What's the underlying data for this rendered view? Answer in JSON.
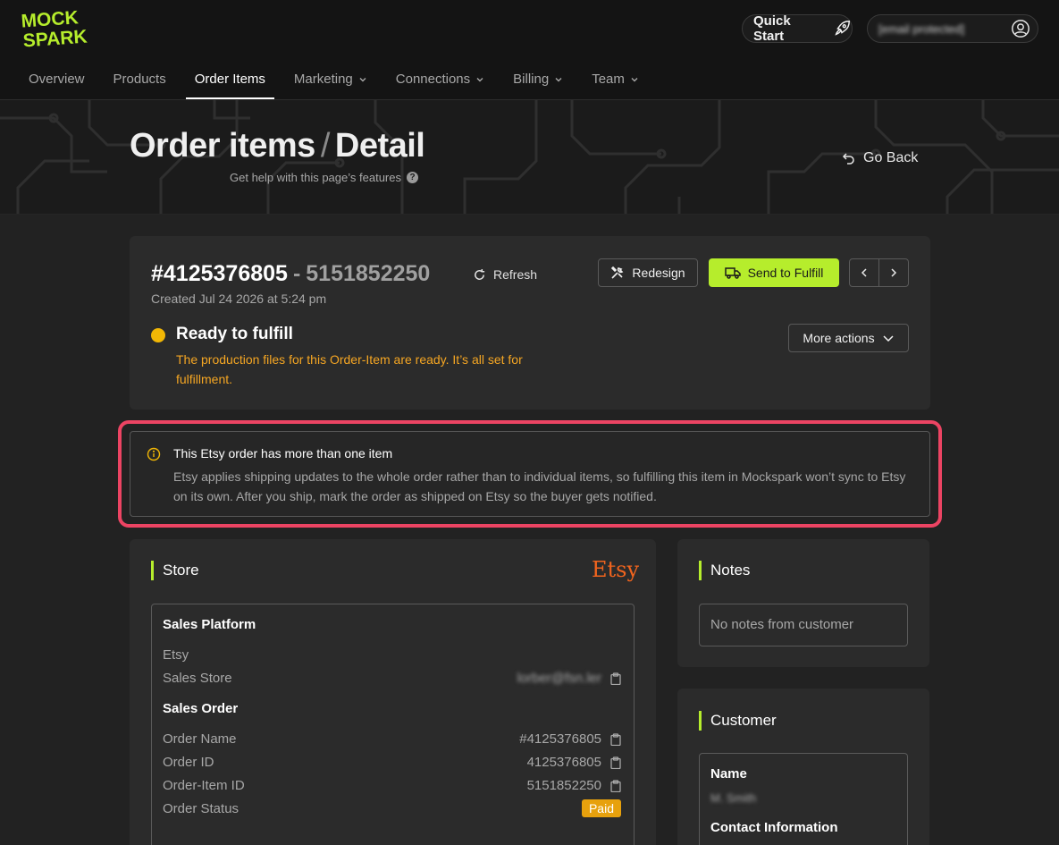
{
  "brand": {
    "logo_line1": "MOCK",
    "logo_line2": "SPARK",
    "accent": "#b6ed2c"
  },
  "header": {
    "quick_start": "Quick Start",
    "account_email": "[email protected]",
    "nav": [
      {
        "label": "Overview",
        "dropdown": false,
        "active": false
      },
      {
        "label": "Products",
        "dropdown": false,
        "active": false
      },
      {
        "label": "Order Items",
        "dropdown": false,
        "active": true
      },
      {
        "label": "Marketing",
        "dropdown": true,
        "active": false
      },
      {
        "label": "Connections",
        "dropdown": true,
        "active": false
      },
      {
        "label": "Billing",
        "dropdown": true,
        "active": false
      },
      {
        "label": "Team",
        "dropdown": true,
        "active": false
      }
    ]
  },
  "hero": {
    "title_part1": "Order items",
    "separator": "/",
    "title_part2": "Detail",
    "help_text": "Get help with this page’s features",
    "go_back": "Go Back"
  },
  "order": {
    "number": "#4125376805",
    "dash": "-",
    "item_id": "5151852250",
    "refresh": "Refresh",
    "created": "Created Jul 24 2026 at 5:24 pm",
    "redesign": "Redesign",
    "send_to_fulfill": "Send to Fulfill",
    "more_actions": "More actions",
    "status_title": "Ready to fulfill",
    "status_desc": "The production files for this Order-Item are ready. It’s all set for fulfillment.",
    "status_color": "#f2b705"
  },
  "alert": {
    "title": "This Etsy order has more than one item",
    "body": "Etsy applies shipping updates to the whole order rather than to individual items, so fulfilling this item in Mockspark won’t sync to Etsy on its own. After you ship, mark the order as shipped on Etsy so the buyer gets notified.",
    "highlight_color": "#ec4463"
  },
  "store": {
    "title": "Store",
    "platform_logo": "Etsy",
    "sales_platform_heading": "Sales Platform",
    "platform_name": "Etsy",
    "sales_store_label": "Sales Store",
    "sales_store_value": "lorber@fsn.ler",
    "sales_order_heading": "Sales Order",
    "order_name_label": "Order Name",
    "order_name_value": "#4125376805",
    "order_id_label": "Order ID",
    "order_id_value": "4125376805",
    "order_item_id_label": "Order-Item ID",
    "order_item_id_value": "5151852250",
    "order_status_label": "Order Status",
    "order_status_value": "Paid"
  },
  "notes": {
    "title": "Notes",
    "empty_text": "No notes from customer"
  },
  "customer": {
    "title": "Customer",
    "name_heading": "Name",
    "name_value": "M. Smith",
    "contact_heading": "Contact Information"
  }
}
